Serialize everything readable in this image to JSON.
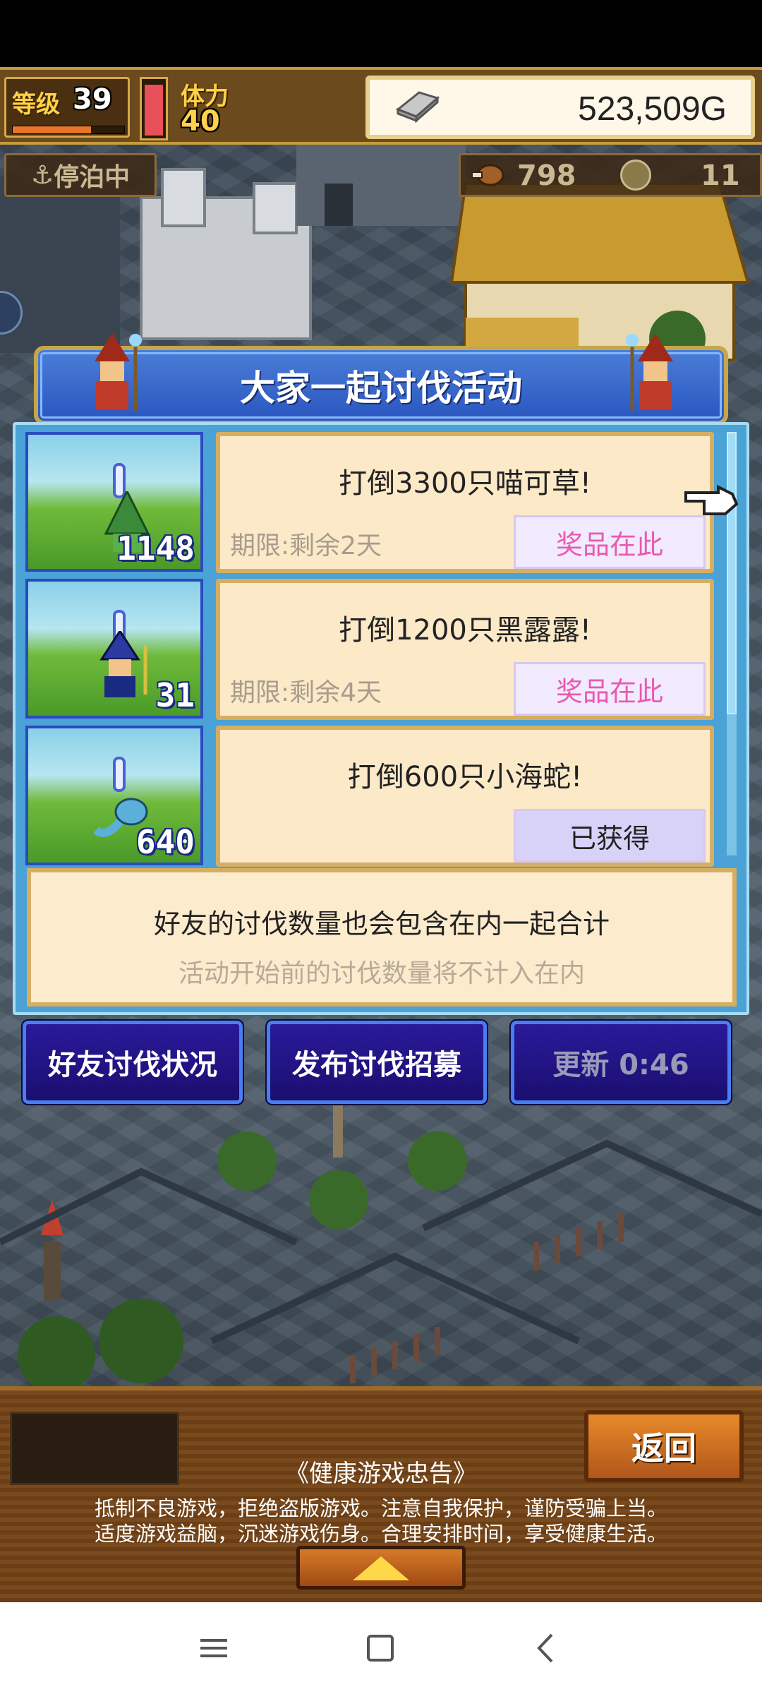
{
  "hud": {
    "level_label": "等级",
    "level_value": "39",
    "level_progress": 0.7,
    "stamina_label": "体力",
    "stamina_value": "40",
    "stamina_fill": 0.95,
    "gold_value": "523,509G"
  },
  "status": {
    "dock_label": "停泊中",
    "meat_value": "798",
    "coin_value": "11"
  },
  "event": {
    "title": "大家一起讨伐活动",
    "quests": [
      {
        "title": "打倒3300只喵可草!",
        "deadline": "期限:剩余2天",
        "count": "1148",
        "button": "奖品在此",
        "state": "available"
      },
      {
        "title": "打倒1200只黑露露!",
        "deadline": "期限:剩余4天",
        "count": "31",
        "button": "奖品在此",
        "state": "available"
      },
      {
        "title": "打倒600只小海蛇!",
        "deadline": "",
        "count": "640",
        "button": "已获得",
        "state": "obtained"
      }
    ],
    "note_main": "好友的讨伐数量也会包含在内一起合计",
    "note_sub": "活动开始前的讨伐数量将不计入在内"
  },
  "actions": {
    "friends_status": "好友讨伐状况",
    "publish_recruit": "发布讨伐招募",
    "refresh": "更新 0:46"
  },
  "footer": {
    "back": "返回",
    "health_title": "《健康游戏忠告》",
    "health_line1": "抵制不良游戏，拒绝盗版游戏。注意自我保护，谨防受骗上当。",
    "health_line2": "适度游戏益脑，沉迷游戏伤身。合理安排时间，享受健康生活。"
  },
  "icons": {
    "gold": "silver-ingot-icon",
    "meat": "meat-icon",
    "coin": "coin-icon",
    "anchor": "anchor-icon",
    "hand": "pointer-hand-icon"
  },
  "colors": {
    "panel_blue": "#4aa2d6",
    "title_blue": "#2a56c0",
    "card_cream": "#fbe9c8",
    "prize_pink": "#e85ab0",
    "button_navy": "#1a0f70"
  }
}
